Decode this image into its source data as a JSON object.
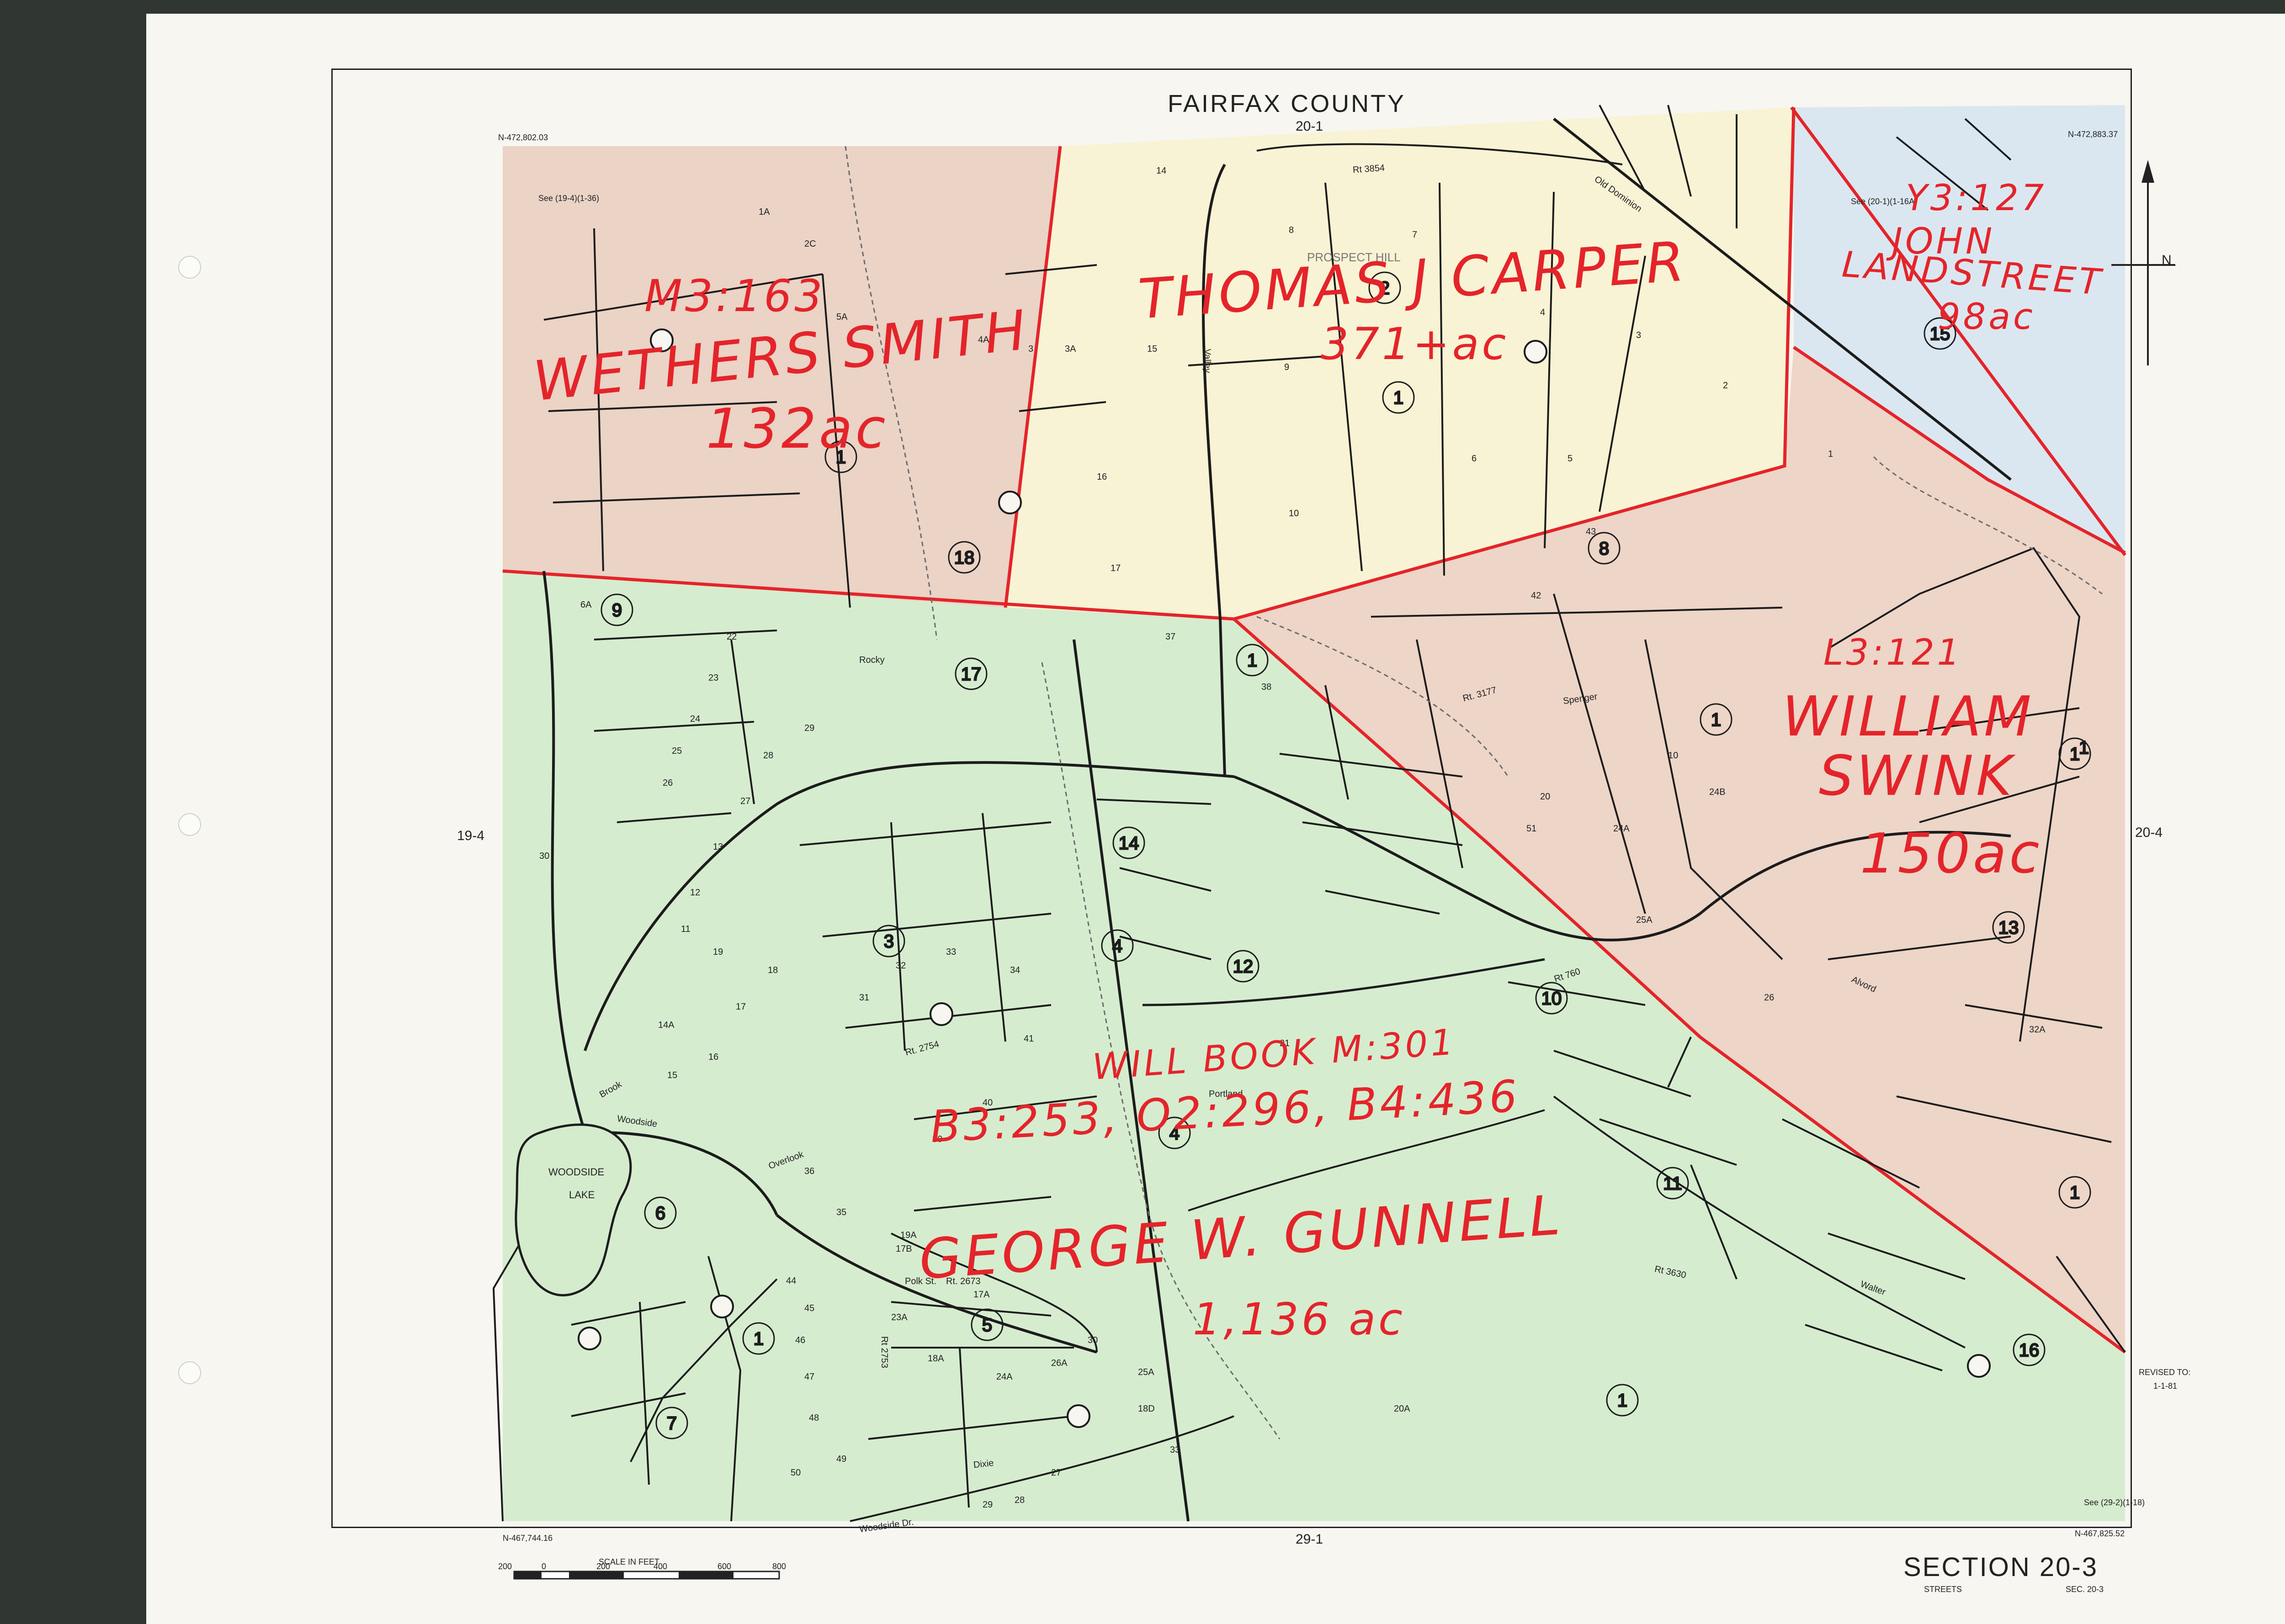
{
  "sheet": {
    "county_title": "FAIRFAX   COUNTY",
    "section_title": "SECTION  20-3",
    "section_sub": "STREETS",
    "section_code": "SEC. 20-3",
    "revised_label": "REVISED TO:",
    "revised_date": "1-1-81",
    "edge_top": "20-1",
    "edge_bottom": "29-1",
    "edge_left": "19-4",
    "edge_right": "20-4",
    "coord_nw": "N-472,802.03",
    "coord_ne": "N-472,883.37",
    "coord_sw": "N-467,744.16",
    "coord_se": "N-467,825.52",
    "see_ref_nw": "See (19-4)(1-36)",
    "see_ref_ne": "See (20-1)(1-16A)",
    "see_ref_se": "See (29-2)(1-18)",
    "scale_label": "SCALE     IN     FEET",
    "scale_ticks": [
      "200",
      "0",
      "200",
      "400",
      "600",
      "800"
    ],
    "compass_n": "N"
  },
  "places": {
    "lake_label": "WOODSIDE",
    "lake_label2": "LAKE",
    "prospect_hill": "PROSPECT    HILL"
  },
  "roads": {
    "woodside": "Woodside",
    "woodside_dr": "Woodside    Dr.",
    "brook": "Brook",
    "overlook": "Overlook",
    "portland": "Portland",
    "walter": "Walter",
    "alvord": "Alvord",
    "spenger": "Spenger",
    "polk": "Polk  St.",
    "dixie": "Dixie",
    "valley": "Valley",
    "rocky": "Rocky",
    "old_dominion": "Old    Dominion",
    "rt_3854": "Rt  3854",
    "rt_760": "Rt 760",
    "rt_3177": "Rt. 3177",
    "rt_2754": "Rt. 2754",
    "rt_2673": "Rt. 2673",
    "rt_2753": "Rt  2753",
    "rt_3630": "Rt  3630"
  },
  "owners": {
    "nw_ref": "M3:163",
    "nw_name": "WETHERS SMITH",
    "nw_acres": "132ac",
    "n_name": "THOMAS J CARPER",
    "n_acres": "371+ac",
    "ne_ref": "Y3:127",
    "ne_name1": "JOHN",
    "ne_name2": "LANDSTREET",
    "ne_acres": "98ac",
    "e_ref": "L3:121",
    "e_name1": "WILLIAM",
    "e_name2": "SWINK",
    "e_acres": "150ac",
    "s_will": "WILL BOOK M:301",
    "s_refs": "B3:253,  O2:296, B4:436",
    "s_name": "GEORGE W. GUNNELL",
    "s_acres": "1,136 ac"
  },
  "parcels": {
    "big": [
      "1",
      "2",
      "1",
      "15",
      "18",
      "1",
      "9",
      "17",
      "1",
      "8",
      "1",
      "14",
      "3",
      "4",
      "12",
      "10",
      "13",
      "1",
      "6",
      "1",
      "5",
      "7",
      "4",
      "11",
      "16",
      "1",
      "1"
    ],
    "lots": [
      "1A",
      "2C",
      "5A",
      "4A",
      "3",
      "3A",
      "14",
      "15",
      "16",
      "17",
      "10",
      "9",
      "8",
      "7",
      "6",
      "5",
      "4",
      "3",
      "2",
      "1",
      "6A",
      "22",
      "23",
      "24",
      "25",
      "26",
      "27",
      "28",
      "29",
      "30",
      "31",
      "32",
      "33",
      "34",
      "35",
      "36",
      "37",
      "38",
      "39",
      "40",
      "41",
      "42",
      "43",
      "44",
      "45",
      "46",
      "47",
      "48",
      "49",
      "50",
      "51",
      "20",
      "21",
      "19",
      "18",
      "17",
      "16",
      "15",
      "14A",
      "13",
      "12",
      "11",
      "10",
      "24B",
      "24A",
      "25A",
      "26",
      "32A",
      "20A",
      "33",
      "27",
      "28",
      "29",
      "30",
      "25A",
      "26A",
      "24A",
      "23A",
      "18A",
      "19A",
      "17B",
      "17A",
      "18D",
      "26B"
    ]
  },
  "colors": {
    "red_ink": "#e4242a",
    "smith_fill": "#e9cfc1",
    "carper_fill": "#f8f2d2",
    "landstreet_fill": "#d9e6ef",
    "swink_fill": "#ecd3c5",
    "gunnell_fill": "#d4ebcc",
    "line": "#1c1c1c",
    "background": "#2f3631",
    "paper": "#f7f6f1"
  }
}
